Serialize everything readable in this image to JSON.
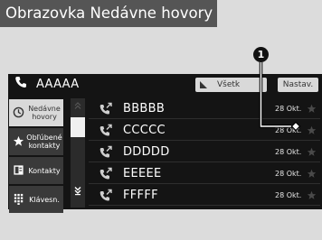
{
  "title": "Obrazovka Nedávne hovory",
  "header": {
    "contact_name": "AAAAA",
    "filter_label": "Všetk",
    "settings_label": "Nastav."
  },
  "nav": {
    "recent": "Nedávne hovory",
    "favorites": "Obľúbené kontakty",
    "contacts": "Kontakty",
    "keypad": "Klávesn."
  },
  "calls": [
    {
      "name": "BBBBB",
      "date": "28 Okt."
    },
    {
      "name": "CCCCC",
      "date": "28 Okt."
    },
    {
      "name": "DDDDD",
      "date": "28 Okt."
    },
    {
      "name": "EEEEE",
      "date": "28 Okt."
    },
    {
      "name": "FFFFF",
      "date": "28 Okt."
    }
  ],
  "callout": {
    "number": "1"
  },
  "colors": {
    "title_bg": "#555555",
    "screen_bg": "#141414",
    "button_bg": "#d9d9d9",
    "call_icon": "#cfcfcf"
  },
  "icons": {
    "header": "phone-icon",
    "row": "outgoing-call-icon",
    "favorite": "star-icon",
    "nav_recent": "clock-icon",
    "nav_favorites": "star-icon",
    "nav_contacts": "contact-card-icon",
    "nav_keypad": "keypad-icon"
  }
}
